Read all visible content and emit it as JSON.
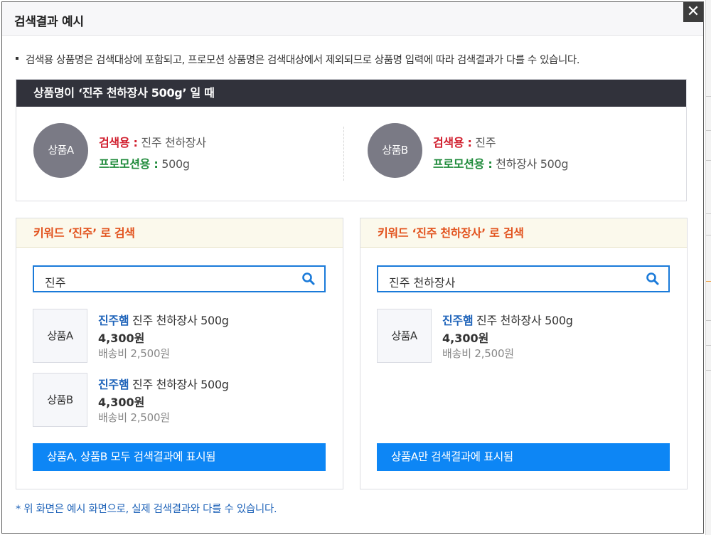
{
  "modal": {
    "title": "검색결과 예시",
    "close_glyph": "✕"
  },
  "notice": {
    "text": "검색용 상품명은 검색대상에 포함되고, 프로모션 상품명은 검색대상에서 제외되므로 상품명 입력에 따라 검색결과가 다를 수 있습니다."
  },
  "case": {
    "heading": "상품명이 ‘진주 천하장사 500g’ 일 때",
    "products": [
      {
        "badge": "상품A",
        "search_label": "검색용 :",
        "search_value": " 진주 천하장사",
        "promo_label": "프로모션용 :",
        "promo_value": " 500g"
      },
      {
        "badge": "상품B",
        "search_label": "검색용 :",
        "search_value": " 진주",
        "promo_label": "프로모션용 :",
        "promo_value": " 천하장사 500g"
      }
    ]
  },
  "panels": [
    {
      "heading": "키워드 ‘진주’ 로 검색",
      "search_value": "진주",
      "results": [
        {
          "thumb": "상품A",
          "brand": "진주햄",
          "name": " 진주 천하장사 500g",
          "price": "4,300원",
          "shipping": "배송비 2,500원"
        },
        {
          "thumb": "상품B",
          "brand": "진주햄",
          "name": " 진주 천하장사 500g",
          "price": "4,300원",
          "shipping": "배송비 2,500원"
        }
      ],
      "result_text": "상품A, 상품B 모두 검색결과에 표시됨"
    },
    {
      "heading": "키워드 ‘진주 천하장사’ 로 검색",
      "search_value": "진주 천하장사",
      "results": [
        {
          "thumb": "상품A",
          "brand": "진주햄",
          "name": " 진주 천하장사 500g",
          "price": "4,300원",
          "shipping": "배송비 2,500원"
        }
      ],
      "result_text": "상품A만 검색결과에 표시됨"
    }
  ],
  "footnote": "* 위 화면은 예시 화면으로, 실제 검색결과와 다를 수 있습니다.",
  "colors": {
    "header_dark": "#31323b",
    "accent_blue": "#0d86f5",
    "search_border": "#1a7ad9",
    "label_red": "#d1202f",
    "label_green": "#1e8a3a",
    "panel_head_text": "#e2521d",
    "panel_head_bg": "#fbf9ec"
  },
  "icons": {
    "search": "search-icon",
    "close": "close-icon"
  }
}
